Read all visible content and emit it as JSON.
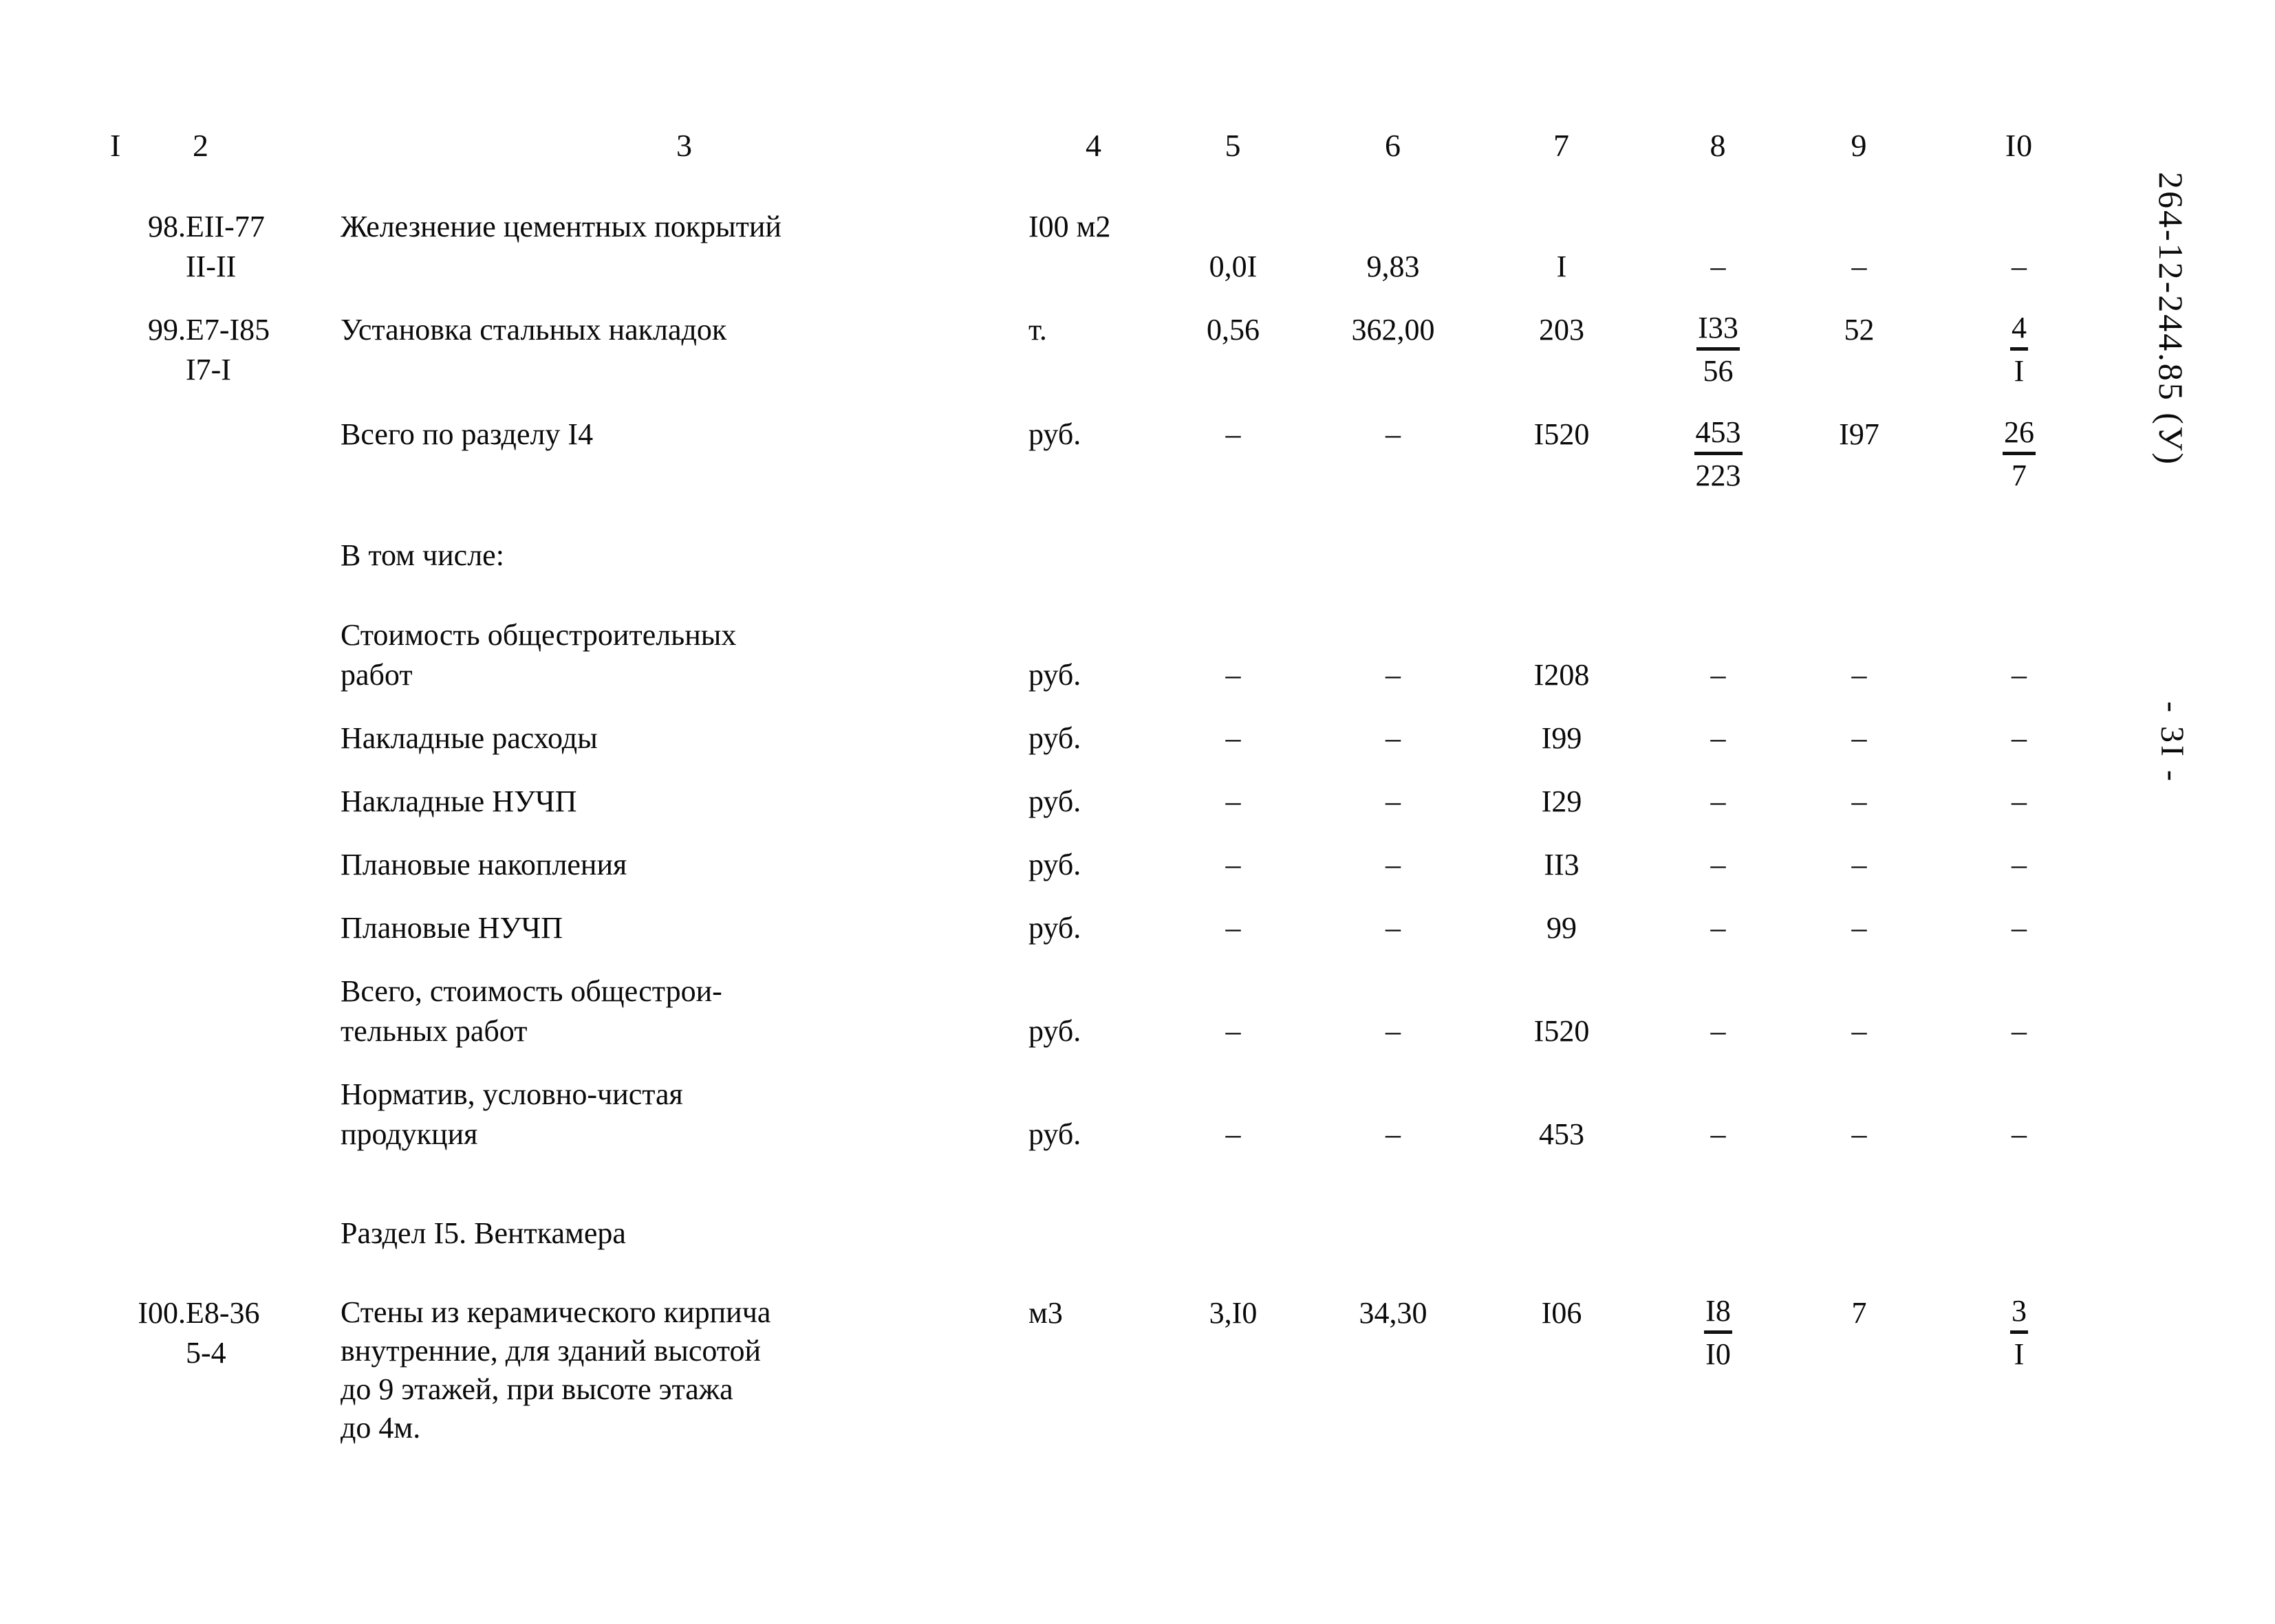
{
  "document": {
    "code_vertical": "264-12-244.85 (У)",
    "page_label": "- 3I -"
  },
  "table": {
    "column_headers": [
      "I",
      "2",
      "3",
      "4",
      "5",
      "6",
      "7",
      "8",
      "9",
      "I0"
    ],
    "rows": [
      {
        "index": "98.",
        "code": "ЕII-77\nII-II",
        "description": "Железнение цементных покрытий",
        "unit": "I00\nм2",
        "c5": "0,0I",
        "c6": "9,83",
        "c7": "I",
        "c8": "–",
        "c9": "–",
        "c10": "–"
      },
      {
        "index": "99.",
        "code": "Е7-I85\nI7-I",
        "description": "Установка стальных накладок",
        "unit": "т.",
        "c5": "0,56",
        "c6": "362,00",
        "c7": "203",
        "c8_num": "I33",
        "c8_den": "56",
        "c9": "52",
        "c10_num": "4",
        "c10_den": "I"
      },
      {
        "index": "",
        "code": "",
        "description": "Всего по разделу I4",
        "unit": "руб.",
        "c5": "–",
        "c6": "–",
        "c7": "I520",
        "c8_num": "453",
        "c8_den": "223",
        "c9": "I97",
        "c10_num": "26",
        "c10_den": "7"
      },
      {
        "index": "",
        "code": "",
        "description": "В том числе:",
        "unit": "",
        "c5": "",
        "c6": "",
        "c7": "",
        "c8": "",
        "c9": "",
        "c10": ""
      },
      {
        "index": "",
        "code": "",
        "description": "Стоимость общестроительных\nработ",
        "unit": "руб.",
        "c5": "–",
        "c6": "–",
        "c7": "I208",
        "c8": "–",
        "c9": "–",
        "c10": "–"
      },
      {
        "index": "",
        "code": "",
        "description": "Накладные расходы",
        "unit": "руб.",
        "c5": "–",
        "c6": "–",
        "c7": "I99",
        "c8": "–",
        "c9": "–",
        "c10": "–"
      },
      {
        "index": "",
        "code": "",
        "description": "Накладные НУЧП",
        "unit": "руб.",
        "c5": "–",
        "c6": "–",
        "c7": "I29",
        "c8": "–",
        "c9": "–",
        "c10": "–"
      },
      {
        "index": "",
        "code": "",
        "description": "Плановые накопления",
        "unit": "руб.",
        "c5": "–",
        "c6": "–",
        "c7": "II3",
        "c8": "–",
        "c9": "–",
        "c10": "–"
      },
      {
        "index": "",
        "code": "",
        "description": "Плановые НУЧП",
        "unit": "руб.",
        "c5": "–",
        "c6": "–",
        "c7": "99",
        "c8": "–",
        "c9": "–",
        "c10": "–"
      },
      {
        "index": "",
        "code": "",
        "description": "Всего, стоимость общестрои-\nтельных работ",
        "unit": "руб.",
        "c5": "–",
        "c6": "–",
        "c7": "I520",
        "c8": "–",
        "c9": "–",
        "c10": "–"
      },
      {
        "index": "",
        "code": "",
        "description": "Норматив, условно-чистая\nпродукция",
        "unit": "руб.",
        "c5": "–",
        "c6": "–",
        "c7": "453",
        "c8": "–",
        "c9": "–",
        "c10": "–"
      }
    ],
    "section_heading": "Раздел I5. Венткамера",
    "final_row": {
      "index": "I00.",
      "code": "Е8-36\n5-4",
      "description": "Стены из керамического кирпича\nвнутренние, для зданий высотой\nдо 9 этажей, при высоте этажа\nдо 4м.",
      "unit": "м3",
      "c5": "3,I0",
      "c6": "34,30",
      "c7": "I06",
      "c8_num": "I8",
      "c8_den": "I0",
      "c9": "7",
      "c10_num": "3",
      "c10_den": "I"
    }
  }
}
